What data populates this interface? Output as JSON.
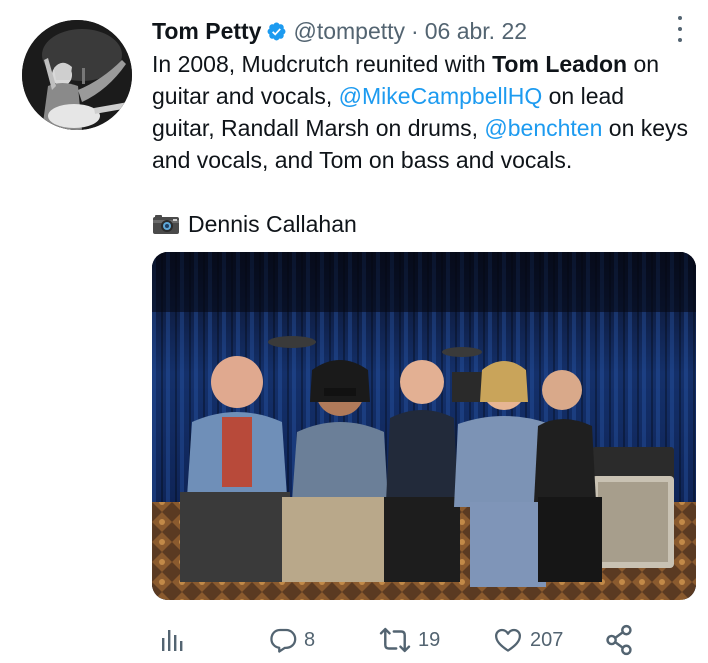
{
  "tweet": {
    "author_name": "Tom Petty",
    "handle": "@tompetty",
    "separator": "·",
    "date": "06 abr. 22",
    "text": {
      "p1": "In 2008, Mudcrutch reunited with ",
      "bold1": "Tom Leadon",
      "p2": " on guitar and vocals, ",
      "mention1": "@MikeCampbellHQ",
      "p3": " on lead guitar, Randall Marsh on drums, ",
      "mention2": "@benchten",
      "p4": " on keys and vocals, and Tom on bass and vocals."
    },
    "photo_credit": "Dennis Callahan"
  },
  "actions": {
    "replies": "8",
    "retweets": "19",
    "likes": "207"
  },
  "icons": {
    "verified": "verified-badge-icon",
    "more": "more-options-icon",
    "camera": "camera-icon",
    "analytics": "analytics-icon",
    "reply": "reply-icon",
    "retweet": "retweet-icon",
    "like": "like-heart-icon",
    "share": "share-icon"
  },
  "colors": {
    "text": "#0f1419",
    "secondary": "#536471",
    "link": "#1d9bf0"
  }
}
